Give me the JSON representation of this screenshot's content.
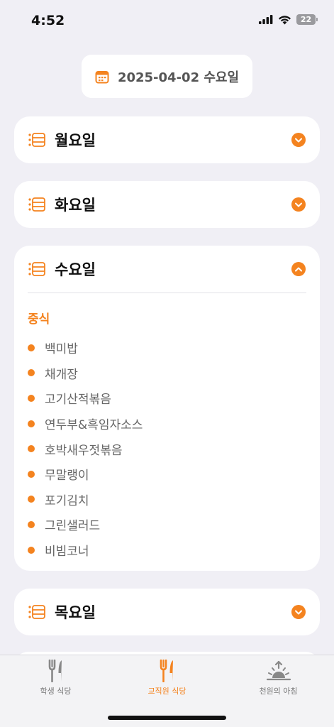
{
  "status_bar": {
    "time": "4:52",
    "battery": "22"
  },
  "date_pill": {
    "text": "2025-04-02 수요일",
    "icon": "calendar-icon"
  },
  "days": [
    {
      "title": "월요일",
      "expanded": false
    },
    {
      "title": "화요일",
      "expanded": false
    },
    {
      "title": "수요일",
      "expanded": true,
      "meal_label": "중식",
      "menu": [
        "백미밥",
        "채개장",
        "고기산적볶음",
        "연두부&흑임자소스",
        "호박새우젓볶음",
        "무말랭이",
        "포기김치",
        "그린샐러드",
        "비빔코너"
      ]
    },
    {
      "title": "목요일",
      "expanded": false
    }
  ],
  "tabs": [
    {
      "label": "학생 식당",
      "icon": "fork-knife-icon",
      "active": false
    },
    {
      "label": "교직원 식당",
      "icon": "fork-knife-icon",
      "active": true
    },
    {
      "label": "천원의 아침",
      "icon": "sunrise-icon",
      "active": false
    }
  ],
  "colors": {
    "accent": "#f4831f",
    "background": "#f0eff5",
    "card": "#ffffff"
  }
}
